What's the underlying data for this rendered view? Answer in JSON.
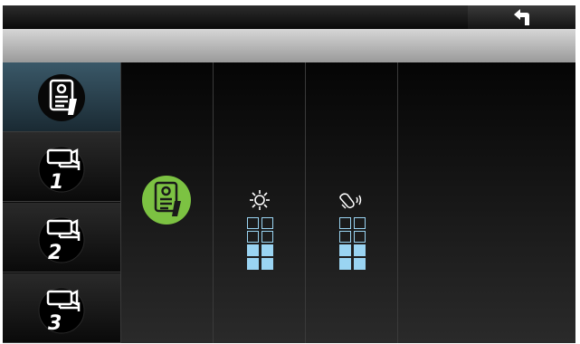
{
  "app": {
    "title_text": "",
    "back_icon": "back-arrow-icon"
  },
  "sidebar": {
    "items": [
      {
        "name": "door-station-1",
        "icon": "door-station-icon",
        "active": true
      },
      {
        "name": "camera-1",
        "icon": "camera-icon",
        "number": "1",
        "active": false
      },
      {
        "name": "camera-2",
        "icon": "camera-icon",
        "number": "2",
        "active": false
      },
      {
        "name": "camera-3",
        "icon": "camera-icon",
        "number": "3",
        "active": false
      }
    ]
  },
  "settings": {
    "selected_device_icon": "door-station-icon",
    "brightness": {
      "icon": "brightness-icon",
      "level": 2,
      "max": 4
    },
    "ring_volume": {
      "icon": "bell-volume-icon",
      "level": 2,
      "max": 4
    }
  },
  "colors": {
    "accent_green": "#7cc242",
    "level_blue": "#9ad4f2",
    "active_item": "#3a5868"
  }
}
